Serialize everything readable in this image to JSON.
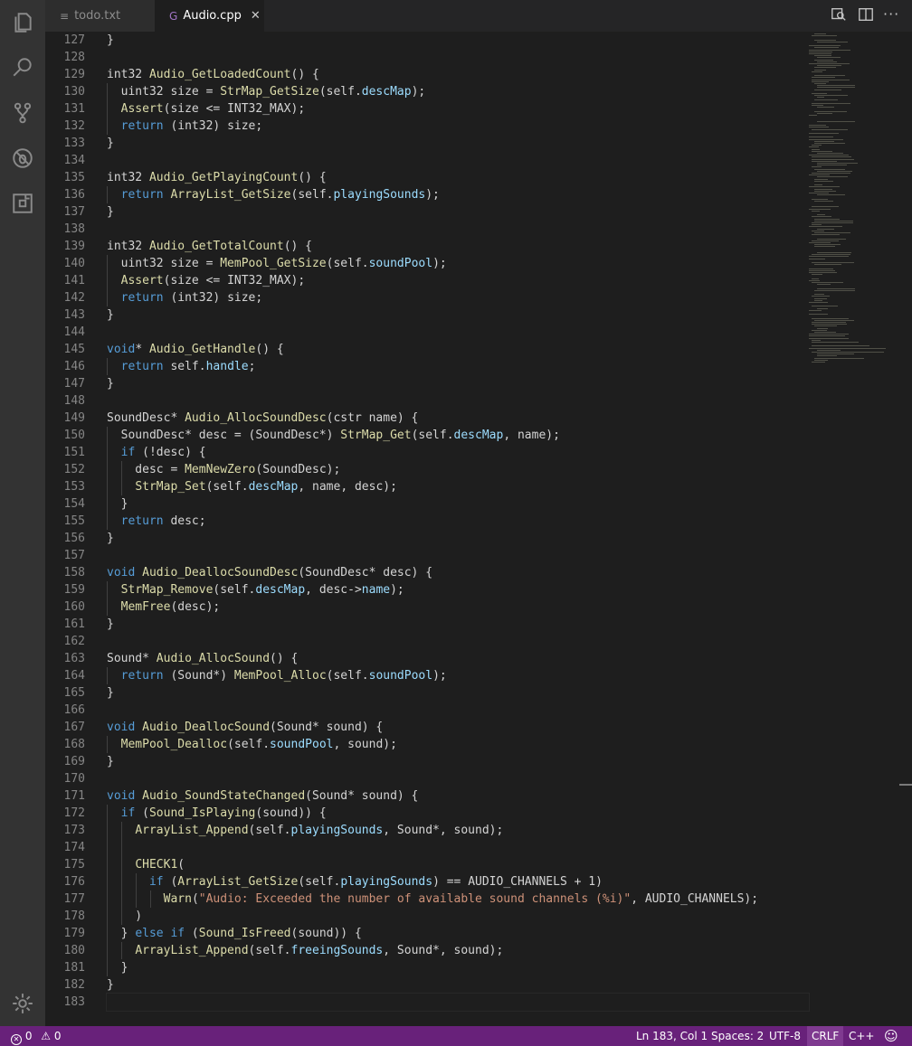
{
  "tabs": [
    {
      "label": "todo.txt",
      "icon": "text-file-icon",
      "active": false
    },
    {
      "label": "Audio.cpp",
      "icon": "cpp-file-icon",
      "active": true,
      "close": "✕"
    }
  ],
  "editor": {
    "lines": [
      {
        "n": "127",
        "html": "}"
      },
      {
        "n": "128",
        "html": ""
      },
      {
        "n": "129",
        "html": "int32 <span class='f'>Audio_GetLoadedCount</span>() {"
      },
      {
        "n": "130",
        "html": "  uint32 size = <span class='f'>StrMap_GetSize</span>(self.<span class='p'>descMap</span>);"
      },
      {
        "n": "131",
        "html": "  <span class='f'>Assert</span>(size &lt;= INT32_MAX);"
      },
      {
        "n": "132",
        "html": "  <span class='k'>return</span> (int32) size;"
      },
      {
        "n": "133",
        "html": "}"
      },
      {
        "n": "134",
        "html": ""
      },
      {
        "n": "135",
        "html": "int32 <span class='f'>Audio_GetPlayingCount</span>() {"
      },
      {
        "n": "136",
        "html": "  <span class='k'>return</span> <span class='f'>ArrayList_GetSize</span>(self.<span class='p'>playingSounds</span>);"
      },
      {
        "n": "137",
        "html": "}"
      },
      {
        "n": "138",
        "html": ""
      },
      {
        "n": "139",
        "html": "int32 <span class='f'>Audio_GetTotalCount</span>() {"
      },
      {
        "n": "140",
        "html": "  uint32 size = <span class='f'>MemPool_GetSize</span>(self.<span class='p'>soundPool</span>);"
      },
      {
        "n": "141",
        "html": "  <span class='f'>Assert</span>(size &lt;= INT32_MAX);"
      },
      {
        "n": "142",
        "html": "  <span class='k'>return</span> (int32) size;"
      },
      {
        "n": "143",
        "html": "}"
      },
      {
        "n": "144",
        "html": ""
      },
      {
        "n": "145",
        "html": "<span class='k'>void</span>* <span class='f'>Audio_GetHandle</span>() {"
      },
      {
        "n": "146",
        "html": "  <span class='k'>return</span> self.<span class='p'>handle</span>;"
      },
      {
        "n": "147",
        "html": "}"
      },
      {
        "n": "148",
        "html": ""
      },
      {
        "n": "149",
        "html": "SoundDesc* <span class='f'>Audio_AllocSoundDesc</span>(cstr name) {"
      },
      {
        "n": "150",
        "html": "  SoundDesc* desc = (SoundDesc*) <span class='f'>StrMap_Get</span>(self.<span class='p'>descMap</span>, name);"
      },
      {
        "n": "151",
        "html": "  <span class='k'>if</span> (!desc) {"
      },
      {
        "n": "152",
        "html": "    desc = <span class='f'>MemNewZero</span>(SoundDesc);"
      },
      {
        "n": "153",
        "html": "    <span class='f'>StrMap_Set</span>(self.<span class='p'>descMap</span>, name, desc);"
      },
      {
        "n": "154",
        "html": "  }"
      },
      {
        "n": "155",
        "html": "  <span class='k'>return</span> desc;"
      },
      {
        "n": "156",
        "html": "}"
      },
      {
        "n": "157",
        "html": ""
      },
      {
        "n": "158",
        "html": "<span class='k'>void</span> <span class='f'>Audio_DeallocSoundDesc</span>(SoundDesc* desc) {"
      },
      {
        "n": "159",
        "html": "  <span class='f'>StrMap_Remove</span>(self.<span class='p'>descMap</span>, desc-&gt;<span class='p'>name</span>);"
      },
      {
        "n": "160",
        "html": "  <span class='f'>MemFree</span>(desc);"
      },
      {
        "n": "161",
        "html": "}"
      },
      {
        "n": "162",
        "html": ""
      },
      {
        "n": "163",
        "html": "Sound* <span class='f'>Audio_AllocSound</span>() {"
      },
      {
        "n": "164",
        "html": "  <span class='k'>return</span> (Sound*) <span class='f'>MemPool_Alloc</span>(self.<span class='p'>soundPool</span>);"
      },
      {
        "n": "165",
        "html": "}"
      },
      {
        "n": "166",
        "html": ""
      },
      {
        "n": "167",
        "html": "<span class='k'>void</span> <span class='f'>Audio_DeallocSound</span>(Sound* sound) {"
      },
      {
        "n": "168",
        "html": "  <span class='f'>MemPool_Dealloc</span>(self.<span class='p'>soundPool</span>, sound);"
      },
      {
        "n": "169",
        "html": "}"
      },
      {
        "n": "170",
        "html": ""
      },
      {
        "n": "171",
        "html": "<span class='k'>void</span> <span class='f'>Audio_SoundStateChanged</span>(Sound* sound) {"
      },
      {
        "n": "172",
        "html": "  <span class='k'>if</span> (<span class='f'>Sound_IsPlaying</span>(sound)) {"
      },
      {
        "n": "173",
        "html": "    <span class='f'>ArrayList_Append</span>(self.<span class='p'>playingSounds</span>, Sound*, sound);"
      },
      {
        "n": "174",
        "html": ""
      },
      {
        "n": "175",
        "html": "    <span class='f'>CHECK1</span>("
      },
      {
        "n": "176",
        "html": "      <span class='k'>if</span> (<span class='f'>ArrayList_GetSize</span>(self.<span class='p'>playingSounds</span>) == AUDIO_CHANNELS + 1)"
      },
      {
        "n": "177",
        "html": "        <span class='f'>Warn</span>(<span class='s'>\"Audio: Exceeded the number of available sound channels (%i)\"</span>, AUDIO_CHANNELS);"
      },
      {
        "n": "178",
        "html": "    )"
      },
      {
        "n": "179",
        "html": "  } <span class='k'>else</span> <span class='k'>if</span> (<span class='f'>Sound_IsFreed</span>(sound)) {"
      },
      {
        "n": "180",
        "html": "    <span class='f'>ArrayList_Append</span>(self.<span class='p'>freeingSounds</span>, Sound*, sound);"
      },
      {
        "n": "181",
        "html": "  }"
      },
      {
        "n": "182",
        "html": "}"
      },
      {
        "n": "183",
        "html": ""
      }
    ]
  },
  "status": {
    "errors": "0",
    "warnings": "0",
    "position": "Ln 183, Col 1",
    "spaces": "Spaces: 2",
    "encoding": "UTF-8",
    "eol": "CRLF",
    "language": "C++"
  },
  "colors": {
    "status_bar": "#68217a",
    "activity_bar": "#333333",
    "editor_bg": "#1e1e1e"
  }
}
